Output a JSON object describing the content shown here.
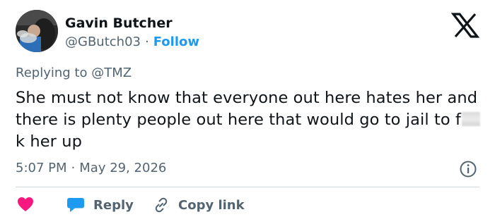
{
  "author": {
    "name": "Gavin Butcher",
    "handle": "@GButch03",
    "separator": "·",
    "follow_label": "Follow"
  },
  "replying": {
    "prefix": "Replying to",
    "mention": "@TMZ"
  },
  "tweet": {
    "text_before_censor": "She must not know that everyone out here hates her and there is plenty people out here that would go to jail to f",
    "text_after_censor": "k her up",
    "time": "5:07 PM",
    "separator": "·",
    "date": "May 29, 2026"
  },
  "actions": {
    "reply_label": "Reply",
    "copy_label": "Copy link"
  },
  "colors": {
    "accent": "#1d9bf0",
    "like": "#f91880",
    "secondary_text": "#536471",
    "primary_text": "#0f1419",
    "divider": "#cfd9de"
  },
  "icons": [
    "avatar",
    "x-logo-icon",
    "info-icon",
    "heart-icon",
    "reply-bubble-icon",
    "link-icon"
  ]
}
